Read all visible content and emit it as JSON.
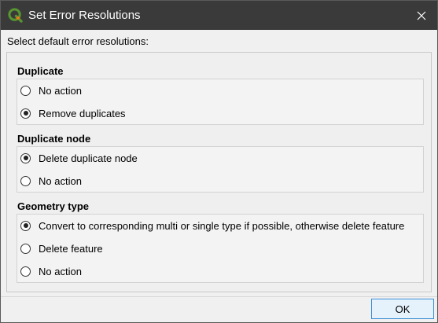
{
  "window": {
    "title": "Set Error Resolutions",
    "app_icon": "qgis-logo-icon",
    "close_icon": "close-icon"
  },
  "prompt": "Select default error resolutions:",
  "groups": [
    {
      "title": "Duplicate",
      "options": [
        {
          "label": "No action",
          "checked": false
        },
        {
          "label": "Remove duplicates",
          "checked": true
        }
      ]
    },
    {
      "title": "Duplicate node",
      "options": [
        {
          "label": "Delete duplicate node",
          "checked": true
        },
        {
          "label": "No action",
          "checked": false
        }
      ]
    },
    {
      "title": "Geometry type",
      "options": [
        {
          "label": "Convert to corresponding multi or single type if possible, otherwise delete feature",
          "checked": true
        },
        {
          "label": "Delete feature",
          "checked": false
        },
        {
          "label": "No action",
          "checked": false
        }
      ]
    }
  ],
  "ok_label": "OK",
  "colors": {
    "titlebar": "#3a3a3a",
    "accent": "#3c8fd6",
    "qgis_green": "#589632",
    "qgis_yellow": "#ee7913"
  }
}
